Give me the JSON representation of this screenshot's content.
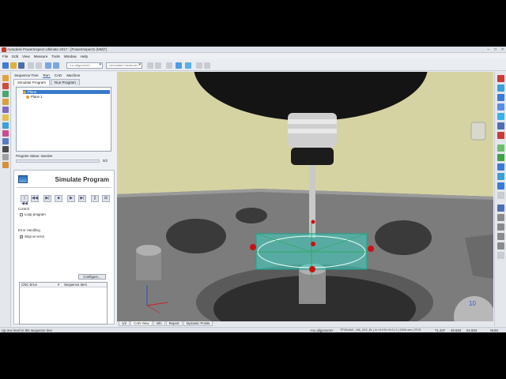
{
  "window": {
    "title": "Autodesk PowerInspect Ultimate 2017 - [PowerInspect1 (MM)*]",
    "controls": [
      "–",
      "□",
      "×"
    ]
  },
  "menu": [
    "File",
    "Edit",
    "View",
    "Measure",
    "Tools",
    "Window",
    "Help"
  ],
  "toolbar": {
    "alignment_combo": "<no alignment>",
    "measure_combo": "<simulated measure>"
  },
  "panel": {
    "top_tabs": [
      "Sequence Tree",
      "Run",
      "CAD",
      "Machine"
    ],
    "sub_tabs": [
      "Simulate Program",
      "Run Program"
    ],
    "tree_items": [
      "Plane",
      "Plane 1"
    ],
    "program_status": "Program status: Inactive",
    "progress": {
      "value": 0,
      "label": "0/2"
    },
    "simulate": {
      "title": "Simulate Program",
      "buttons": [
        "|◀◀",
        "◀◀",
        "▶|",
        "■",
        "▶",
        "▶|",
        "||",
        "⊞"
      ],
      "control_label": "Control",
      "loop_label": "Loop program",
      "error_label": "Error Handling",
      "stop_on_error_label": "Stop on error",
      "configure_label": "Configure...",
      "table_headers": [
        "CNC Error",
        "#",
        "Sequence Item"
      ]
    }
  },
  "viewport": {
    "tabs": [
      "1/2",
      "CAD View",
      "Info",
      "Report",
      "Dynamic Points"
    ],
    "badge": "10"
  },
  "status": {
    "hint": "Up one level in the sequence tree",
    "alignment": "<no alignment>",
    "probe": "TP20x2k2 - M2_2X2_EL | A:+0.0 B:+0.0 | 0 | 2000 mm | PCS",
    "x": "71.337",
    "y": "49.683",
    "z": "64.683",
    "state": "NUM"
  },
  "colors": {
    "background": "#d6d3a3",
    "part": "#8a8a8a",
    "selection": "#3bd1c1",
    "point": "#cc1010",
    "accent": "#3779c9"
  }
}
